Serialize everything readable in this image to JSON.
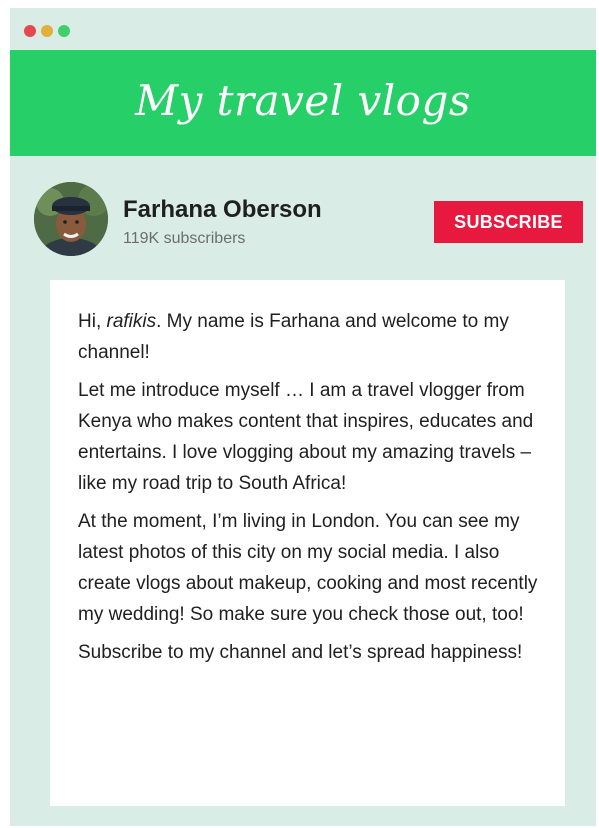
{
  "window": {
    "controls": [
      "close",
      "minimize",
      "maximize"
    ]
  },
  "banner": {
    "title": "My travel vlogs",
    "color": "#27cf68"
  },
  "channel": {
    "name": "Farhana Oberson",
    "subscribers": "119K subscribers",
    "subscribe_label": "SUBSCRIBE",
    "subscribe_color": "#e8193f",
    "avatar_icon": "profile-photo"
  },
  "about": {
    "p1_pre": "Hi, ",
    "p1_em": "rafikis",
    "p1_post": ". My name is Farhana and welcome to my channel!",
    "p2": "Let me introduce myself … I am a travel vlogger from Kenya who makes content that inspires, educates and entertains. I love vlogging about my amazing travels – like my road trip to South Africa!",
    "p3": "At the moment, I’m living in London. You can see my latest photos of this city on my social media. I also create vlogs about makeup, cooking and most recently my wedding! So make sure you check those out, too!",
    "p4": "Subscribe to my channel and let’s spread happiness!"
  }
}
